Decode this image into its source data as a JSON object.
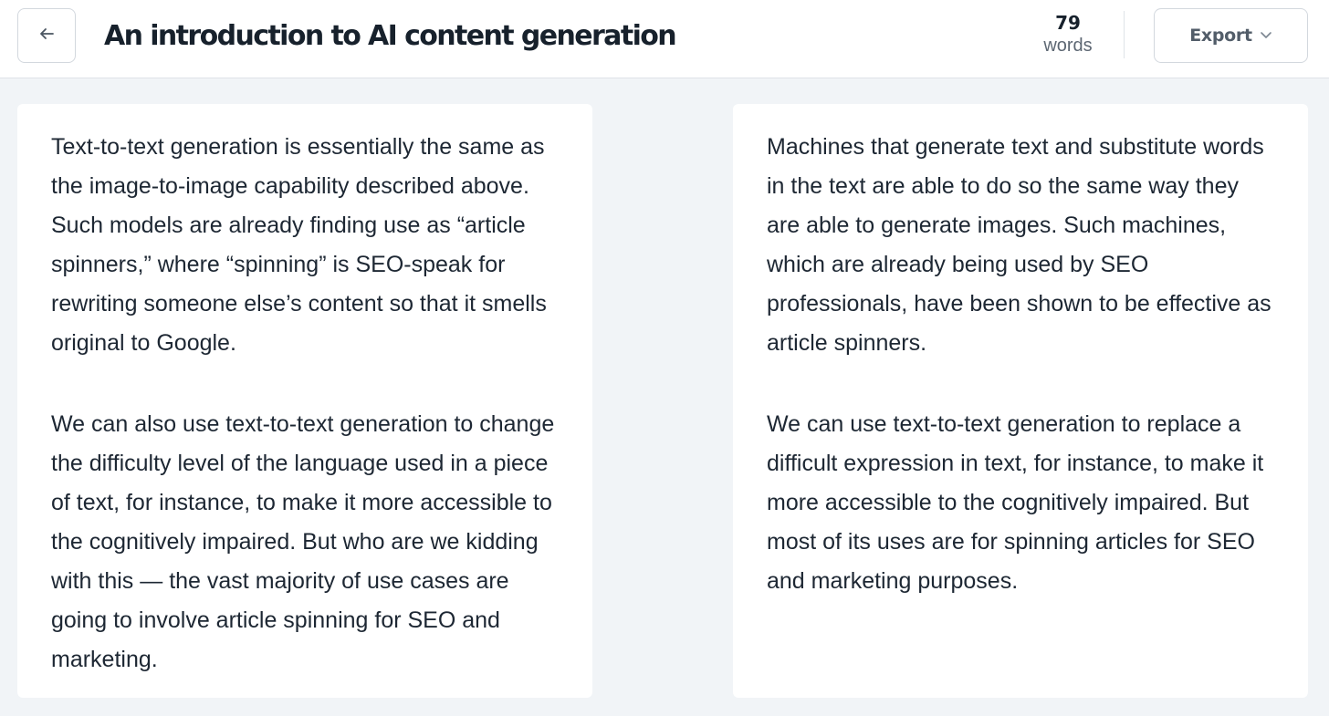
{
  "header": {
    "title": "An introduction to AI content generation",
    "word_count": "79",
    "word_label": "words",
    "export_label": "Export"
  },
  "icons": {
    "back": "arrow-left-icon",
    "export_dropdown": "chevron-down-icon"
  },
  "colors": {
    "page_background": "#f1f4f7",
    "card_background": "#ffffff",
    "text": "#1d2733",
    "muted_text": "#5d6773"
  },
  "columns": [
    {
      "paragraphs": [
        "Text-to-text generation is essentially the same as the image-to-image capability described above. Such models are already finding use as “article spinners,” where “spinning” is SEO-speak for rewriting someone else’s content so that it smells original to Google.",
        "We can also use text-to-text generation to change the difficulty level of the language used in a piece of text, for instance, to make it more accessible to the cognitively impaired. But who are we kidding with this — the vast majority of use cases are going to involve article spinning for SEO and marketing."
      ]
    },
    {
      "paragraphs": [
        "Machines that generate text and substitute words in the text are able to do so the same way they are able to generate images. Such machines, which are already being used by SEO professionals, have been shown to be effective as article spinners.",
        "We can use text-to-text generation to replace a difficult expression in text, for instance, to make it more accessible to the cognitively impaired. But most of its uses are for spinning articles for SEO and marketing purposes."
      ]
    }
  ]
}
